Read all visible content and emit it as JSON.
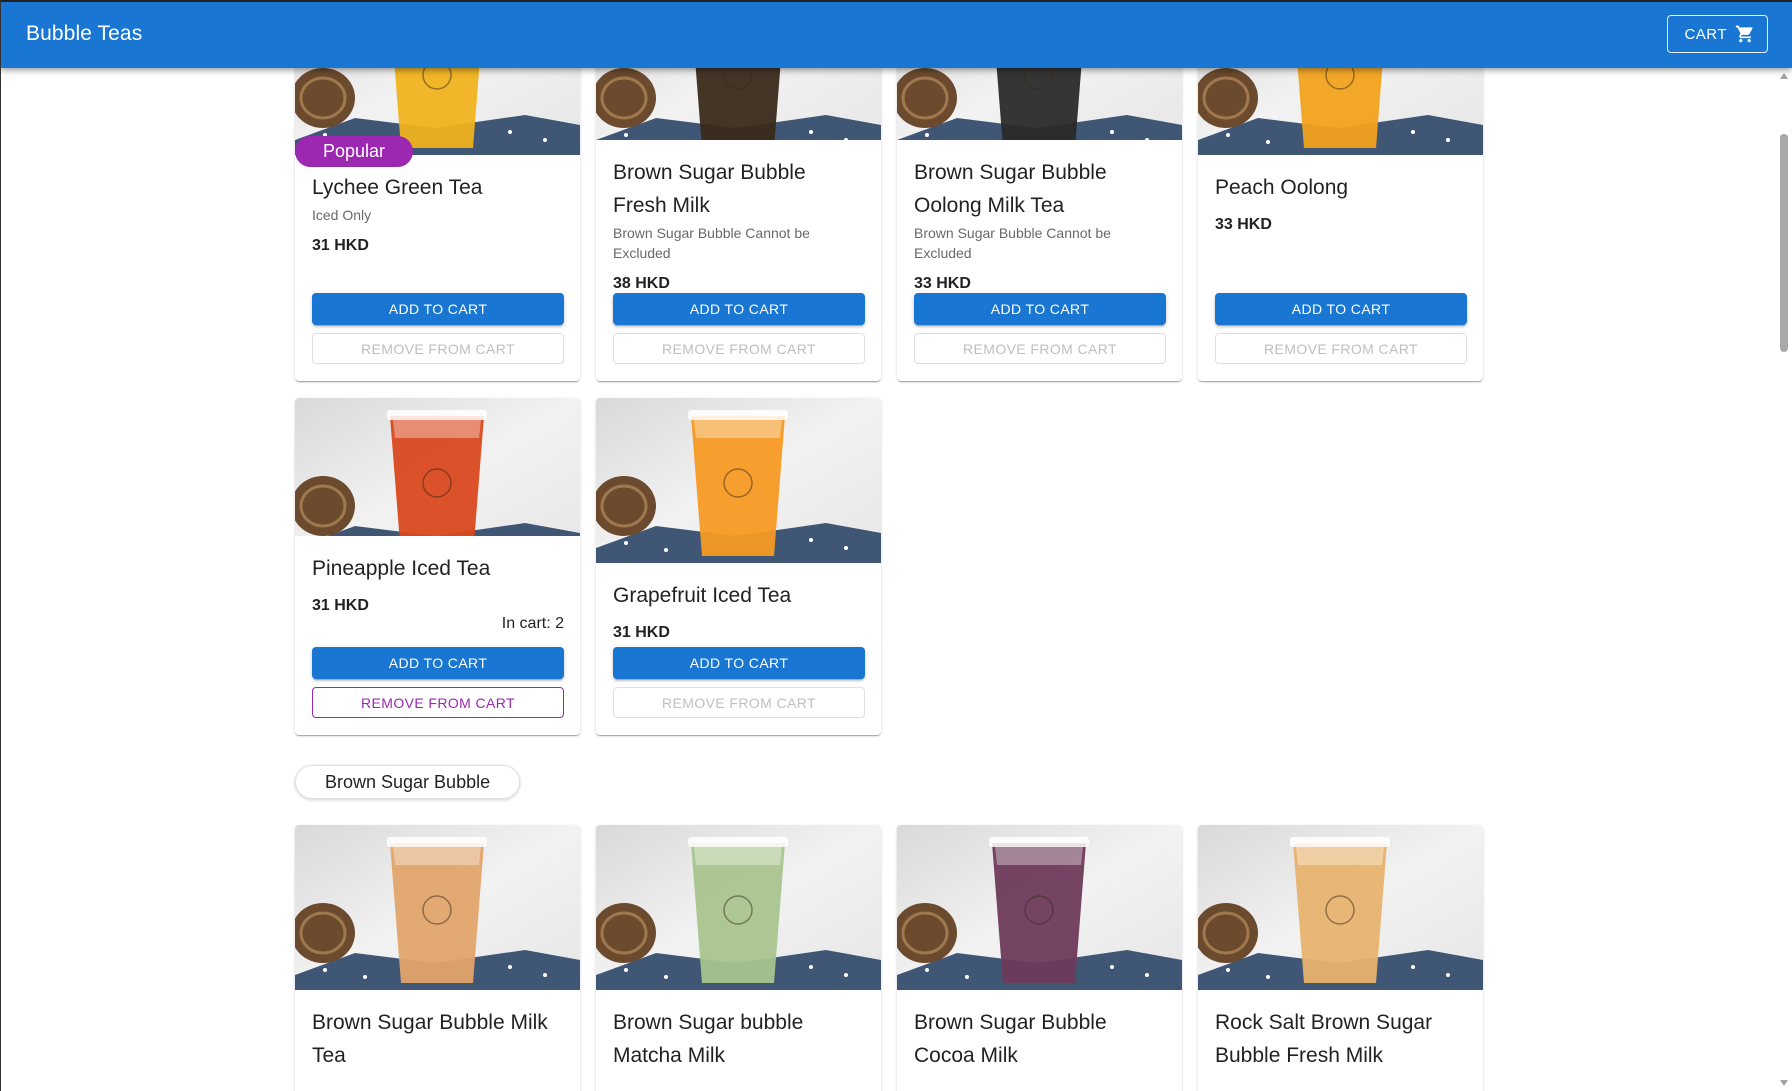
{
  "appbar": {
    "title": "Bubble Teas",
    "cart_label": "CART",
    "cart_icon": "shopping-cart-icon"
  },
  "buttons": {
    "add": "ADD TO CART",
    "remove": "REMOVE FROM CART"
  },
  "section_top": {
    "items": [
      {
        "name": "Lychee Green Tea",
        "badge": "Popular",
        "description": "Iced Only",
        "price": "31 HKD",
        "drink_color": "#f0b21e"
      },
      {
        "name": "Brown Sugar Bubble Fresh Milk",
        "description": "Brown Sugar Bubble Cannot be Excluded",
        "price": "38 HKD",
        "drink_color": "#3a2a1a"
      },
      {
        "name": "Brown Sugar Bubble Oolong Milk Tea",
        "description": "Brown Sugar Bubble Cannot be Excluded",
        "price": "33 HKD",
        "drink_color": "#2a2a2a"
      },
      {
        "name": "Peach Oolong",
        "price": "33 HKD",
        "drink_color": "#f2a21c"
      },
      {
        "name": "Pineapple Iced Tea",
        "price": "31 HKD",
        "in_cart": "In cart: 2",
        "drink_color": "#d9481e"
      },
      {
        "name": "Grapefruit Iced Tea",
        "price": "31 HKD",
        "drink_color": "#f59a23"
      }
    ]
  },
  "section_brown_sugar": {
    "title": "Brown Sugar Bubble",
    "items": [
      {
        "name": "Brown Sugar Bubble Milk Tea",
        "drink_color": "#e2a46a"
      },
      {
        "name": "Brown Sugar bubble Matcha Milk",
        "drink_color": "#a9c48e"
      },
      {
        "name": "Brown Sugar Bubble Cocoa Milk",
        "drink_color": "#6e3a5a"
      },
      {
        "name": "Rock Salt Brown Sugar Bubble Fresh Milk",
        "drink_color": "#e8b36e"
      }
    ]
  },
  "colors": {
    "primary": "#1976d2",
    "secondary": "#9c27b0"
  }
}
